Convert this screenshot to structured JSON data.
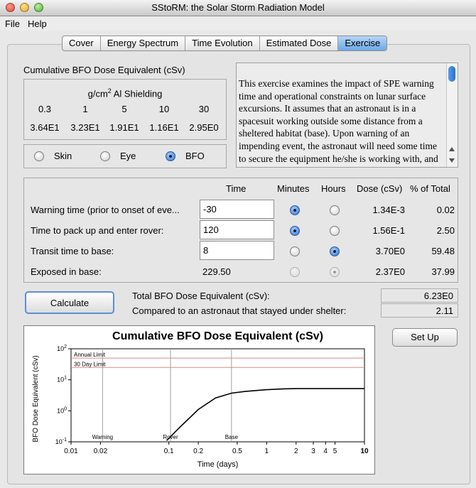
{
  "window": {
    "title": "SStoRM: the Solar Storm Radiation Model"
  },
  "menu": {
    "file": "File",
    "help": "Help"
  },
  "tabs": [
    "Cover",
    "Energy Spectrum",
    "Time Evolution",
    "Estimated Dose",
    "Exercise"
  ],
  "shielding": {
    "section_title": "Cumulative BFO Dose Equivalent (cSv)",
    "header_units": "g/cm",
    "header_sup": "2",
    "header_rest": " Al Shielding",
    "thicknesses": [
      "0.3",
      "1",
      "5",
      "10",
      "30"
    ],
    "doses": [
      "3.64E1",
      "3.23E1",
      "1.91E1",
      "1.16E1",
      "2.95E0"
    ]
  },
  "organ": {
    "skin": "Skin",
    "eye": "Eye",
    "bfo": "BFO",
    "selected": "BFO"
  },
  "description": "This exercise examines the impact of SPE warning time and operational constraints on lunar surface excursions. It assumes that an astronaut is in a spacesuit working outside some distance from a sheltered habitat (base). Upon warning of an impending event, the astronaut will need some time to secure the equipment he/she is working with, and will then return to the base in a lightly",
  "table": {
    "headers": {
      "time": "Time",
      "minutes": "Minutes",
      "hours": "Hours",
      "dose": "Dose (cSv)",
      "percent": "% of Total"
    },
    "rows": [
      {
        "label": "Warning time (prior to onset of eve...",
        "time": "-30",
        "unit": "minutes",
        "dose": "1.34E-3",
        "percent": "0.02"
      },
      {
        "label": "Time to pack up and enter rover:",
        "time": "120",
        "unit": "minutes",
        "dose": "1.56E-1",
        "percent": "2.50"
      },
      {
        "label": "Transit time to base:",
        "time": "8",
        "unit": "hours",
        "dose": "3.70E0",
        "percent": "59.48"
      },
      {
        "label": "Exposed in base:",
        "time": "229.50",
        "unit": "hours",
        "dose": "2.37E0",
        "percent": "37.99"
      }
    ]
  },
  "buttons": {
    "calculate": "Calculate",
    "setup": "Set Up"
  },
  "totals": {
    "total_label": "Total BFO Dose Equivalent (cSv):",
    "total_value": "6.23E0",
    "compare_label": "Compared to an astronaut that stayed under shelter:",
    "compare_value": "2.11"
  },
  "chart_data": {
    "type": "line",
    "title": "Cumulative BFO Dose Equivalent (cSv)",
    "xlabel": "Time (days)",
    "ylabel": "BFO Dose Equivalent (cSv)",
    "x_scale": "log",
    "y_scale": "log",
    "xlim": [
      0.01,
      10
    ],
    "ylim": [
      0.1,
      100
    ],
    "x_ticks": [
      {
        "v": 0.01,
        "label": "0.01"
      },
      {
        "v": 0.02,
        "label": "0.02"
      },
      {
        "v": 0.1,
        "label": "0.1"
      },
      {
        "v": 0.2,
        "label": "0.2"
      },
      {
        "v": 0.5,
        "label": "0.5"
      },
      {
        "v": 1,
        "label": "1"
      },
      {
        "v": 2,
        "label": "2"
      },
      {
        "v": 3,
        "label": "3"
      },
      {
        "v": 4,
        "label": "4"
      },
      {
        "v": 5,
        "label": "5"
      },
      {
        "v": 10,
        "label": "10"
      }
    ],
    "y_ticks": [
      {
        "v": 0.1,
        "base": "10",
        "exp": "-1"
      },
      {
        "v": 1,
        "base": "10",
        "exp": "0"
      },
      {
        "v": 10,
        "base": "10",
        "exp": "1"
      },
      {
        "v": 100,
        "base": "10",
        "exp": "2"
      }
    ],
    "limits": [
      {
        "label": "Annual Limit",
        "value": 50,
        "color": "#d98a8a"
      },
      {
        "label": "30 Day Limit",
        "value": 25,
        "color": "#d98a8a"
      }
    ],
    "markers": [
      {
        "label": "Warning",
        "x": 0.021
      },
      {
        "label": "Rover",
        "x": 0.104
      },
      {
        "label": "Base",
        "x": 0.437
      }
    ],
    "series": [
      {
        "color": "#000000",
        "x": [
          0.095,
          0.13,
          0.2,
          0.3,
          0.437,
          0.6,
          1.0,
          1.5,
          2.0,
          3.0,
          5.0,
          10.0
        ],
        "y": [
          0.11,
          0.3,
          1.1,
          2.6,
          3.7,
          4.2,
          4.8,
          5.1,
          5.2,
          5.2,
          5.2,
          5.2
        ]
      }
    ]
  }
}
